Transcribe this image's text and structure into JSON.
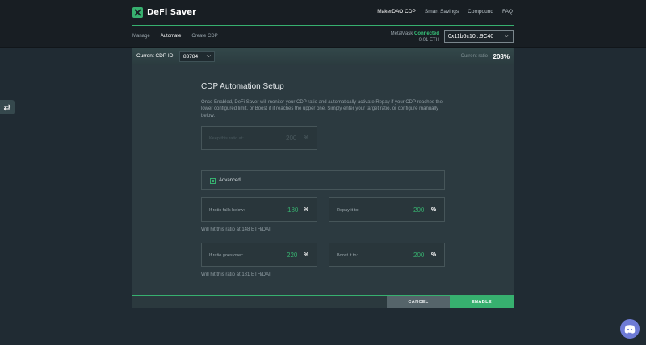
{
  "header": {
    "logo_text": "DeFi Saver",
    "nav": [
      {
        "label": "MakerDAO CDP",
        "active": true
      },
      {
        "label": "Smart Savings",
        "active": false
      },
      {
        "label": "Compound",
        "active": false
      },
      {
        "label": "FAQ",
        "active": false
      }
    ]
  },
  "subnav": {
    "items": [
      {
        "label": "Manage",
        "active": false
      },
      {
        "label": "Automate",
        "active": true
      },
      {
        "label": "Create CDP",
        "active": false
      }
    ]
  },
  "wallet": {
    "provider": "MetaMask",
    "status": "Connected",
    "balance": "0.01 ETH",
    "address": "0x11b6c10...9C40"
  },
  "cdp": {
    "label": "Current CDP ID",
    "id": "83784",
    "ratio_label": "Current ratio",
    "ratio": "208%"
  },
  "panel": {
    "title": "CDP Automation Setup",
    "description": "Once Enabled, DeFi Saver will monitor your CDP ratio and automatically activate Repay if your CDP reaches the lower configured limit, or Boost if it reaches the upper one. Simply enter your target ratio, or configure manually below.",
    "keep_ratio": {
      "label": "Keep this ratio at:",
      "value": "200",
      "unit": "%"
    },
    "advanced_label": "Advanced",
    "repay_trigger": {
      "label": "If ratio falls below:",
      "value": "180",
      "unit": "%"
    },
    "repay_target": {
      "label": "Repay it to:",
      "value": "200",
      "unit": "%"
    },
    "repay_hint": "Will hit this ratio at 148 ETH/DAI",
    "boost_trigger": {
      "label": "If ratio goes over:",
      "value": "220",
      "unit": "%"
    },
    "boost_target": {
      "label": "Boost it to:",
      "value": "200",
      "unit": "%"
    },
    "boost_hint": "Will hit this ratio at 181 ETH/DAI"
  },
  "buttons": {
    "cancel": "CANCEL",
    "enable": "ENABLE"
  },
  "colors": {
    "accent": "#37b06f",
    "background": "#202b33",
    "panel": "#2c3a40"
  }
}
